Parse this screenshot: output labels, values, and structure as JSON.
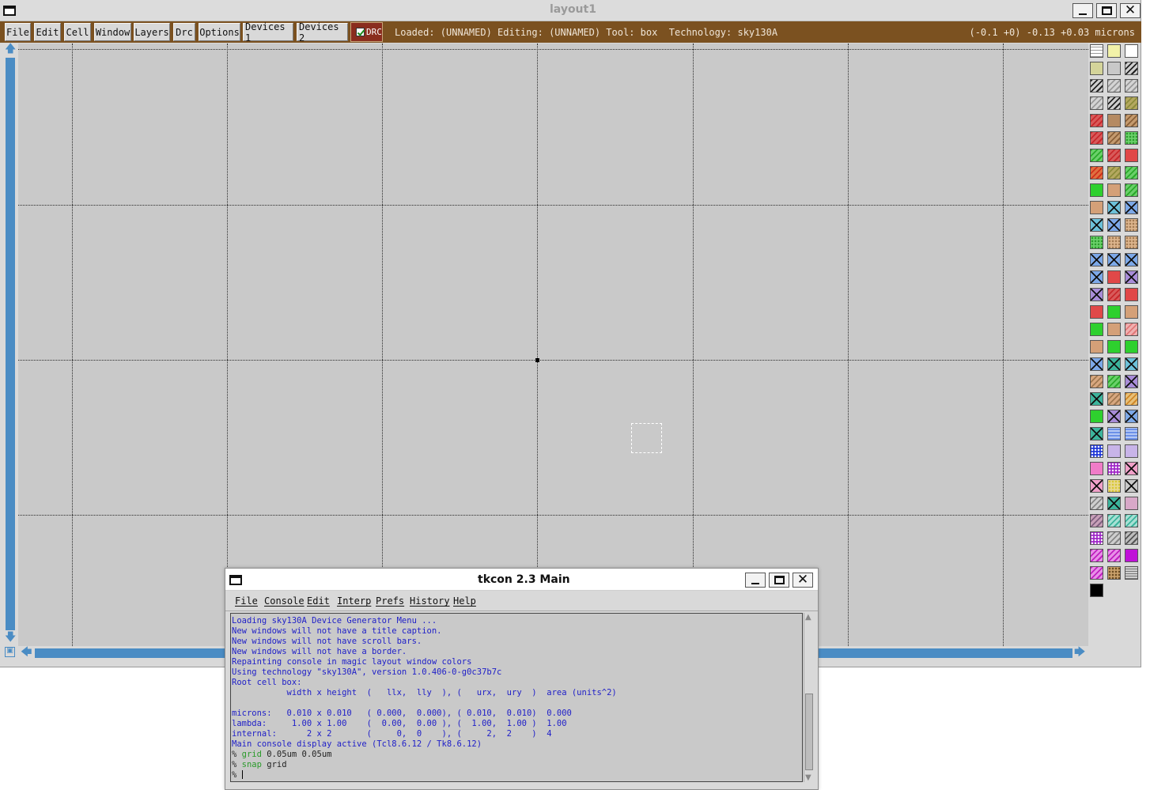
{
  "magic": {
    "title": "layout1",
    "menu": [
      "File",
      "Edit",
      "Cell",
      "Window",
      "Layers",
      "Drc",
      "Options",
      "Devices 1",
      "Devices 2"
    ],
    "drc_label": "DRC",
    "status": "Loaded: (UNNAMED) Editing: (UNNAMED) Tool: box  Technology: sky130A",
    "coords": "(-0.1 +0) -0.13 +0.03 microns",
    "colors": {
      "toolbar": "#7b5120",
      "canvas": "#c9c9c9",
      "scroll": "#4a8cc4",
      "drc": "#8a2d1e"
    }
  },
  "palette": {
    "layers": [
      [
        "grid-white",
        "pale-yellow",
        "outline-white"
      ],
      [
        "pale-olive",
        "light-gray",
        "diag-black"
      ],
      [
        "diag-black",
        "diag-gray",
        "diag-gray"
      ],
      [
        "diag-gray",
        "diag-black",
        "olive-hatch"
      ],
      [
        "red-hatch",
        "brown",
        "brown-hatch"
      ],
      [
        "red-hatch",
        "brown-hatch",
        "green-dots"
      ],
      [
        "green-hatch",
        "red-hatch",
        "red-solid"
      ],
      [
        "red-orange-hatch",
        "olive-hatch",
        "green-hatch"
      ],
      [
        "green-solid",
        "tan",
        "green-hatch"
      ],
      [
        "tan",
        "cyan-x",
        "blue-x"
      ],
      [
        "cyan-x",
        "blue-x",
        "tan-dots"
      ],
      [
        "green-dots",
        "tan-dots",
        "tan-dots"
      ],
      [
        "blue-x",
        "blue-x",
        "blue-x"
      ],
      [
        "blue-x",
        "red-solid",
        "purple-x"
      ],
      [
        "purple-x",
        "red-hatch",
        "red-solid"
      ],
      [
        "red-solid",
        "green-solid",
        "tan"
      ],
      [
        "green-solid",
        "tan",
        "pink-hatch"
      ],
      [
        "tan",
        "green-solid",
        "green-solid"
      ],
      [
        "blue-x",
        "teal-x",
        "cyan-x"
      ],
      [
        "tan-hatch",
        "green-hatch",
        "purple-x"
      ],
      [
        "teal-x",
        "tan-hatch",
        "orange-hatch"
      ],
      [
        "green-solid",
        "purple-x",
        "blue-x"
      ],
      [
        "teal-x",
        "blue-wave",
        "blue-wave"
      ],
      [
        "blue-check",
        "lavender",
        "lavender"
      ],
      [
        "pink",
        "purple-dots",
        "pink-x"
      ],
      [
        "pink-x",
        "yellow-dots",
        "gray-x"
      ],
      [
        "gray-hatch",
        "teal-x",
        "mauve"
      ],
      [
        "mauve-hatch",
        "teal-hatch",
        "teal-hatch"
      ],
      [
        "purple-dots",
        "gray-hatch",
        "gray-diag"
      ],
      [
        "magenta-hatch",
        "magenta-hatch",
        "magenta-solid"
      ],
      [
        "magenta-hatch",
        "brown-dots",
        "gray-lines"
      ],
      [
        "black"
      ]
    ]
  },
  "tkcon": {
    "title": "tkcon 2.3 Main",
    "menu": [
      "File",
      "Console",
      "Edit",
      "Interp",
      "Prefs",
      "History",
      "Help"
    ],
    "lines": [
      "Loading sky130A Device Generator Menu ...",
      "New windows will not have a title caption.",
      "New windows will not have scroll bars.",
      "New windows will not have a border.",
      "Repainting console in magic layout window colors",
      "Using technology \"sky130A\", version 1.0.406-0-g0c37b7c",
      "Root cell box:",
      "           width x height  (   llx,  lly  ), (   urx,  ury  )  area (units^2)",
      "",
      "microns:   0.010 x 0.010   ( 0.000,  0.000), ( 0.010,  0.010)  0.000",
      "lambda:     1.00 x 1.00    (  0.00,  0.00 ), (  1.00,  1.00 )  1.00",
      "internal:      2 x 2       (     0,  0    ), (     2,  2    )  4",
      "Main console display active (Tcl8.6.12 / Tk8.6.12)"
    ],
    "commands": [
      {
        "prompt": "%",
        "cmd": "grid",
        "args": "0.05um 0.05um"
      },
      {
        "prompt": "%",
        "cmd": "snap",
        "args": "grid"
      }
    ],
    "final_prompt": "%"
  }
}
